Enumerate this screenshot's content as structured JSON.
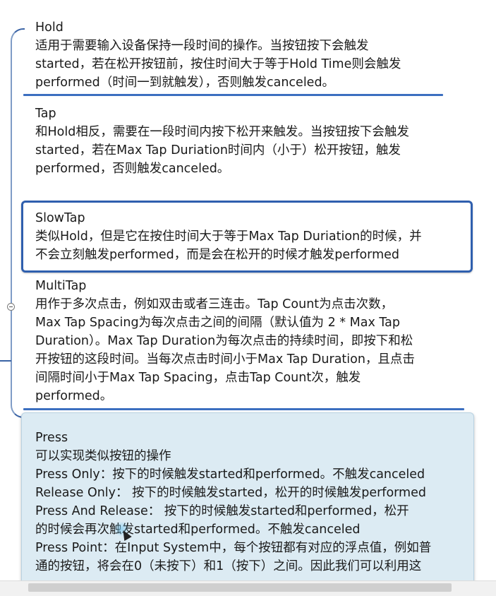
{
  "nodes": {
    "hold": {
      "title": "Hold",
      "lines": [
        "适用于需要输入设备保持一段时间的操作。当按钮按下会触发",
        "started，若在松开按钮前，按住时间大于等于Hold Time则会触发",
        "performed（时间一到就触发），否则触发canceled。"
      ]
    },
    "tap": {
      "title": "Tap",
      "lines": [
        "和Hold相反，需要在一段时间内按下松开来触发。当按钮按下会触发",
        "started，若在Max Tap Duriation时间内（小于）松开按钮，触发",
        "performed，否则触发canceled。"
      ]
    },
    "slowtap": {
      "title": "SlowTap",
      "lines": [
        "类似Hold，但是它在按住时间大于等于Max Tap Duriation的时候，并",
        "不会立刻触发performed，而是会在松开的时候才触发performed"
      ]
    },
    "multitap": {
      "title": "MultiTap",
      "lines": [
        "用作于多次点击，例如双击或者三连击。Tap Count为点击次数，",
        "Max Tap Spacing为每次点击之间的间隔（默认值为 2 * Max Tap",
        "Duration）。Max Tap Duration为每次点击的持续时间，即按下和松",
        "开按钮的这段时间。当每次点击时间小于Max Tap Duration，且点击",
        "间隔时间小于Max Tap Spacing，点击Tap Count次，触发",
        "performed。"
      ]
    },
    "press": {
      "title": "Press",
      "lines": [
        "可以实现类似按钮的操作",
        "Press Only：按下的时候触发started和performed。不触发canceled",
        "Release Only：    按下的时候触发started，松开的时候触发performed",
        "Press And Release：         按下的时候触发started和performed，松开",
        "的时候会再次触发started和performed。不触发canceled",
        "Press Point：在Input System中，每个按钮都有对应的浮点值，例如普",
        "通的按钮，将会在0（未按下）和1（按下）之间。因此我们可以利用这"
      ]
    }
  },
  "colors": {
    "connector": "#3a63a5",
    "selected_border": "#2f5fae",
    "press_fill": "#dcebf3"
  }
}
